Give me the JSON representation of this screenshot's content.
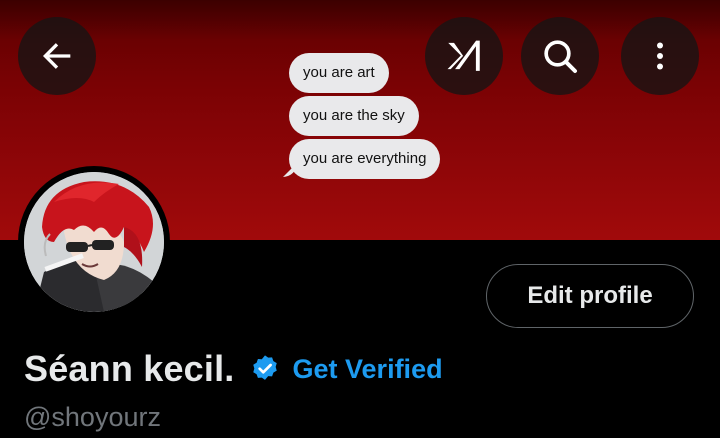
{
  "banner": {
    "messages": [
      "you are art",
      "you are the sky",
      "you are everything"
    ]
  },
  "top_bar": {
    "back_icon": "arrow-left-icon",
    "grok_icon": "grok-icon",
    "search_icon": "search-icon",
    "more_icon": "more-vertical-icon"
  },
  "profile": {
    "display_name": "Séann kecil.",
    "handle": "@shoyourz",
    "edit_label": "Edit profile",
    "get_verified_label": "Get Verified",
    "badge_icon": "verified-badge-icon"
  },
  "colors": {
    "accent": "#1d9bf0",
    "banner": "#8f0608",
    "background": "#000000"
  }
}
